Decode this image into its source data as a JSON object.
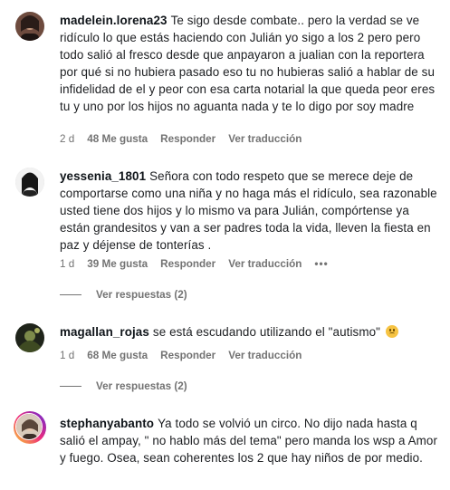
{
  "comments": [
    {
      "username": "madelein.lorena23",
      "text": "Te sigo desde combate.. pero la verdad se ve ridículo lo que estás haciendo con Julián yo sigo a los 2 pero pero todo salió al fresco desde que anpayaron a jualian con la reportera por qué si no hubiera pasado eso tu no hubieras salió a hablar de su infidelidad de el y peor con esa carta notarial la que queda peor eres tu y uno por los hijos no aguanta nada y te lo digo por soy madre",
      "time": "2 d",
      "likes": "48 Me gusta",
      "reply": "Responder",
      "translate": "Ver traducción",
      "avatar_colors": [
        "#3b2a25",
        "#8a5a48"
      ]
    },
    {
      "username": "yessenia_1801",
      "text": "Señora con todo respeto que se merece deje de comportarse como una niña y no haga más el ridículo, sea razonable usted tiene dos hijos y lo mismo va para Julián, compórtense ya están grandesitos y van a ser padres toda la vida, lleven la fiesta en paz y déjense de tonterías .",
      "time": "1 d",
      "likes": "39 Me gusta",
      "reply": "Responder",
      "translate": "Ver traducción",
      "more": "•••",
      "view_replies": "Ver respuestas (2)",
      "avatar_colors": [
        "#e8e8e8",
        "#1c1c1c"
      ]
    },
    {
      "username": "magallan_rojas",
      "text": "se está escudando utilizando el \"autismo\"",
      "time": "1 d",
      "likes": "68 Me gusta",
      "reply": "Responder",
      "translate": "Ver traducción",
      "view_replies": "Ver respuestas (2)",
      "emoji": "downcast-face-emoji",
      "avatar_colors": [
        "#2b2f22",
        "#6b7a3a"
      ]
    },
    {
      "username": "stephanyabanto",
      "text": "Ya todo se volvió un circo. No dijo nada hasta q salió el ampay, \" no hablo más del tema\" pero manda los wsp a Amor y fuego. Osea, sean coherentes los 2 que hay niños de por medio.",
      "avatar_colors": [
        "#c9b8a8",
        "#4a3a30"
      ],
      "story_ring": true
    }
  ]
}
